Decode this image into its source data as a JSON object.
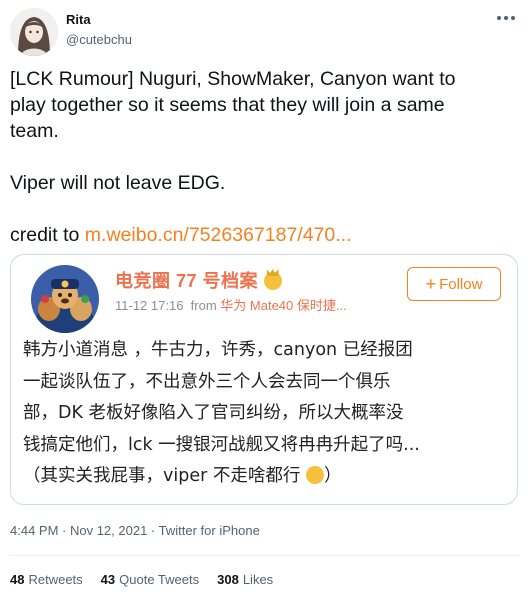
{
  "author": {
    "name": "Rita",
    "handle": "@cutebchu"
  },
  "tweet": {
    "line1": "[LCK Rumour] Nuguri, ShowMaker, Canyon want to",
    "line2": "play together so it seems that they will join a same",
    "line3": "team.",
    "line4": "Viper will not leave EDG.",
    "credit_prefix": "credit to ",
    "credit_link": "m.weibo.cn/7526367187/470..."
  },
  "quote": {
    "name": "电竞圈 77 号档案",
    "time": "11-12 17:16",
    "from_label": "from",
    "from_link": "华为 Mate40 保时捷...",
    "follow_plus": "+",
    "follow_label": "Follow",
    "lines": [
      "韩方小道消息 ，牛古力，许秀，canyon 已经报团",
      "一起谈队伍了，不出意外三个人会去同一个俱乐",
      "部，DK 老板好像陷入了官司纠纷，所以大概率没",
      "钱搞定他们，lck 一搜银河战舰又将冉冉升起了吗...",
      "（其实关我屁事，viper 不走啥都行"
    ],
    "line5_close": "）"
  },
  "footer": {
    "time": "4:44 PM · Nov 12, 2021",
    "sep": " · ",
    "source": "Twitter for iPhone"
  },
  "stats": {
    "retweets_count": "48",
    "retweets_label": "Retweets",
    "quotes_count": "43",
    "quotes_label": "Quote Tweets",
    "likes_count": "308",
    "likes_label": "Likes"
  },
  "icons": {
    "more": "more-horizontal-icon",
    "crown": "crown-emoji",
    "crying": "crying-emoji"
  },
  "colors": {
    "weibo_orange": "#f58220",
    "weibo_name": "#eb7350",
    "secondary_text": "#536471"
  }
}
